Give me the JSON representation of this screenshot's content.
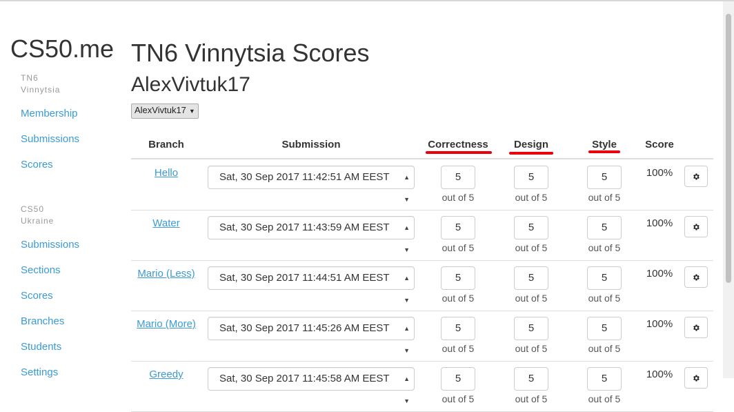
{
  "brand": "CS50.me",
  "sidebar": {
    "group1_heading_line1": "TN6",
    "group1_heading_line2": "Vinnytsia",
    "group1_links": [
      "Membership",
      "Submissions",
      "Scores"
    ],
    "group2_heading_line1": "CS50",
    "group2_heading_line2": "Ukraine",
    "group2_links": [
      "Submissions",
      "Sections",
      "Scores",
      "Branches",
      "Students",
      "Settings"
    ]
  },
  "main": {
    "title": "TN6 Vinnytsia Scores",
    "student_name": "AlexVivtuk17",
    "student_select_value": "AlexVivtuk17"
  },
  "table": {
    "headers": {
      "branch": "Branch",
      "submission": "Submission",
      "correctness": "Correctness",
      "design": "Design",
      "style": "Style",
      "score": "Score"
    },
    "underline_color": "#e8000a",
    "out_of_label": "out of 5",
    "rows": [
      {
        "branch": "Hello",
        "submission": "Sat, 30 Sep 2017 11:42:51 AM EEST",
        "correctness": "5",
        "design": "5",
        "style": "5",
        "score": "100%"
      },
      {
        "branch": "Water",
        "submission": "Sat, 30 Sep 2017 11:43:59 AM EEST",
        "correctness": "5",
        "design": "5",
        "style": "5",
        "score": "100%"
      },
      {
        "branch": "Mario (Less)",
        "submission": "Sat, 30 Sep 2017 11:44:51 AM EEST",
        "correctness": "5",
        "design": "5",
        "style": "5",
        "score": "100%"
      },
      {
        "branch": "Mario (More)",
        "submission": "Sat, 30 Sep 2017 11:45:26 AM EEST",
        "correctness": "5",
        "design": "5",
        "style": "5",
        "score": "100%"
      },
      {
        "branch": "Greedy",
        "submission": "Sat, 30 Sep 2017 11:45:58 AM EEST",
        "correctness": "5",
        "design": "5",
        "style": "5",
        "score": "100%"
      }
    ]
  },
  "colors": {
    "link": "#3a9bd5",
    "text": "#333333",
    "muted": "#999999"
  },
  "icons": {
    "row_action": "gear-icon",
    "select_caret": "caret-down-icon"
  }
}
